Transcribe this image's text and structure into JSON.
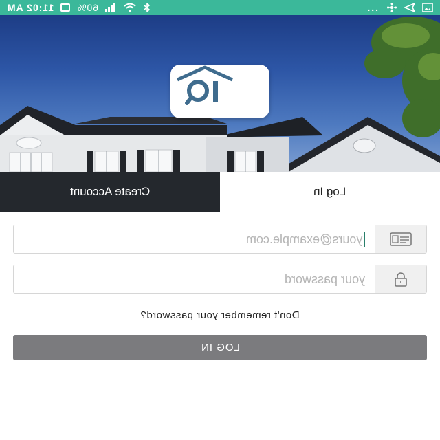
{
  "status_bar": {
    "time": "11:02 AM",
    "battery_percent": "60%",
    "overflow": "...",
    "bg_color": "#3bb89a"
  },
  "hero": {
    "logo_text": "IQ"
  },
  "tabs": [
    {
      "label": "Create Account",
      "active": false
    },
    {
      "label": "Log In",
      "active": true
    }
  ],
  "form": {
    "email_placeholder": "yours@example.com",
    "email_icon": "id-card-icon",
    "password_placeholder": "your password",
    "password_icon": "lock-icon",
    "forgot_link": "Don't remember your password?",
    "submit_label": "LOG IN"
  },
  "colors": {
    "tab_dark": "#24282d",
    "button_gray": "#7b7b7e"
  }
}
